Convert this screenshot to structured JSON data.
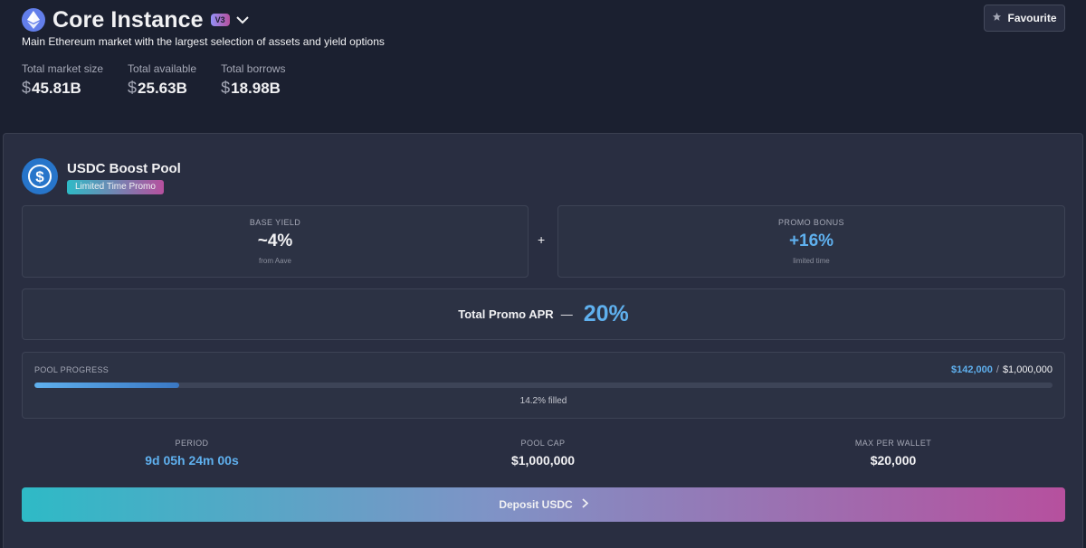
{
  "header": {
    "title": "Core Instance",
    "version": "V3",
    "subtitle": "Main Ethereum market with the largest selection of assets and yield options",
    "favourite_label": "Favourite",
    "stats": [
      {
        "label": "Total market size",
        "currency": "$",
        "value": "45.81B"
      },
      {
        "label": "Total available",
        "currency": "$",
        "value": "25.63B"
      },
      {
        "label": "Total borrows",
        "currency": "$",
        "value": "18.98B"
      }
    ]
  },
  "pool": {
    "title": "USDC Boost Pool",
    "badge": "Limited Time Promo",
    "base_yield": {
      "label": "BASE YIELD",
      "value": "~4%",
      "sub": "from Aave"
    },
    "plus": "+",
    "promo_bonus": {
      "label": "PROMO BONUS",
      "value": "+16%",
      "sub": "limited time"
    },
    "total_apr": {
      "label": "Total Promo APR",
      "dash": "—",
      "value": "20%"
    },
    "progress": {
      "label": "POOL PROGRESS",
      "raised": "$142,000",
      "separator": "/",
      "cap": "$1,000,000",
      "fill_fraction": 0.142,
      "filled_text": "14.2% filled"
    },
    "info": [
      {
        "label": "PERIOD",
        "value": "9d 05h 24m 00s",
        "accent": true
      },
      {
        "label": "POOL CAP",
        "value": "$1,000,000",
        "accent": false
      },
      {
        "label": "MAX PER WALLET",
        "value": "$20,000",
        "accent": false
      }
    ],
    "deposit_label": "Deposit USDC"
  },
  "colors": {
    "background": "#1b2030",
    "card": "#292e41",
    "accent_blue": "#5fb0ee",
    "gradient_start": "#2ebac6",
    "gradient_end": "#b6509e",
    "ethereum": "#627eea",
    "usdc": "#2775ca"
  },
  "icons": {
    "market": "ethereum-icon",
    "version_menu": "chevron-down-icon",
    "favourite": "star-icon",
    "pool": "usdc-icon",
    "deposit": "chevron-right-icon"
  }
}
